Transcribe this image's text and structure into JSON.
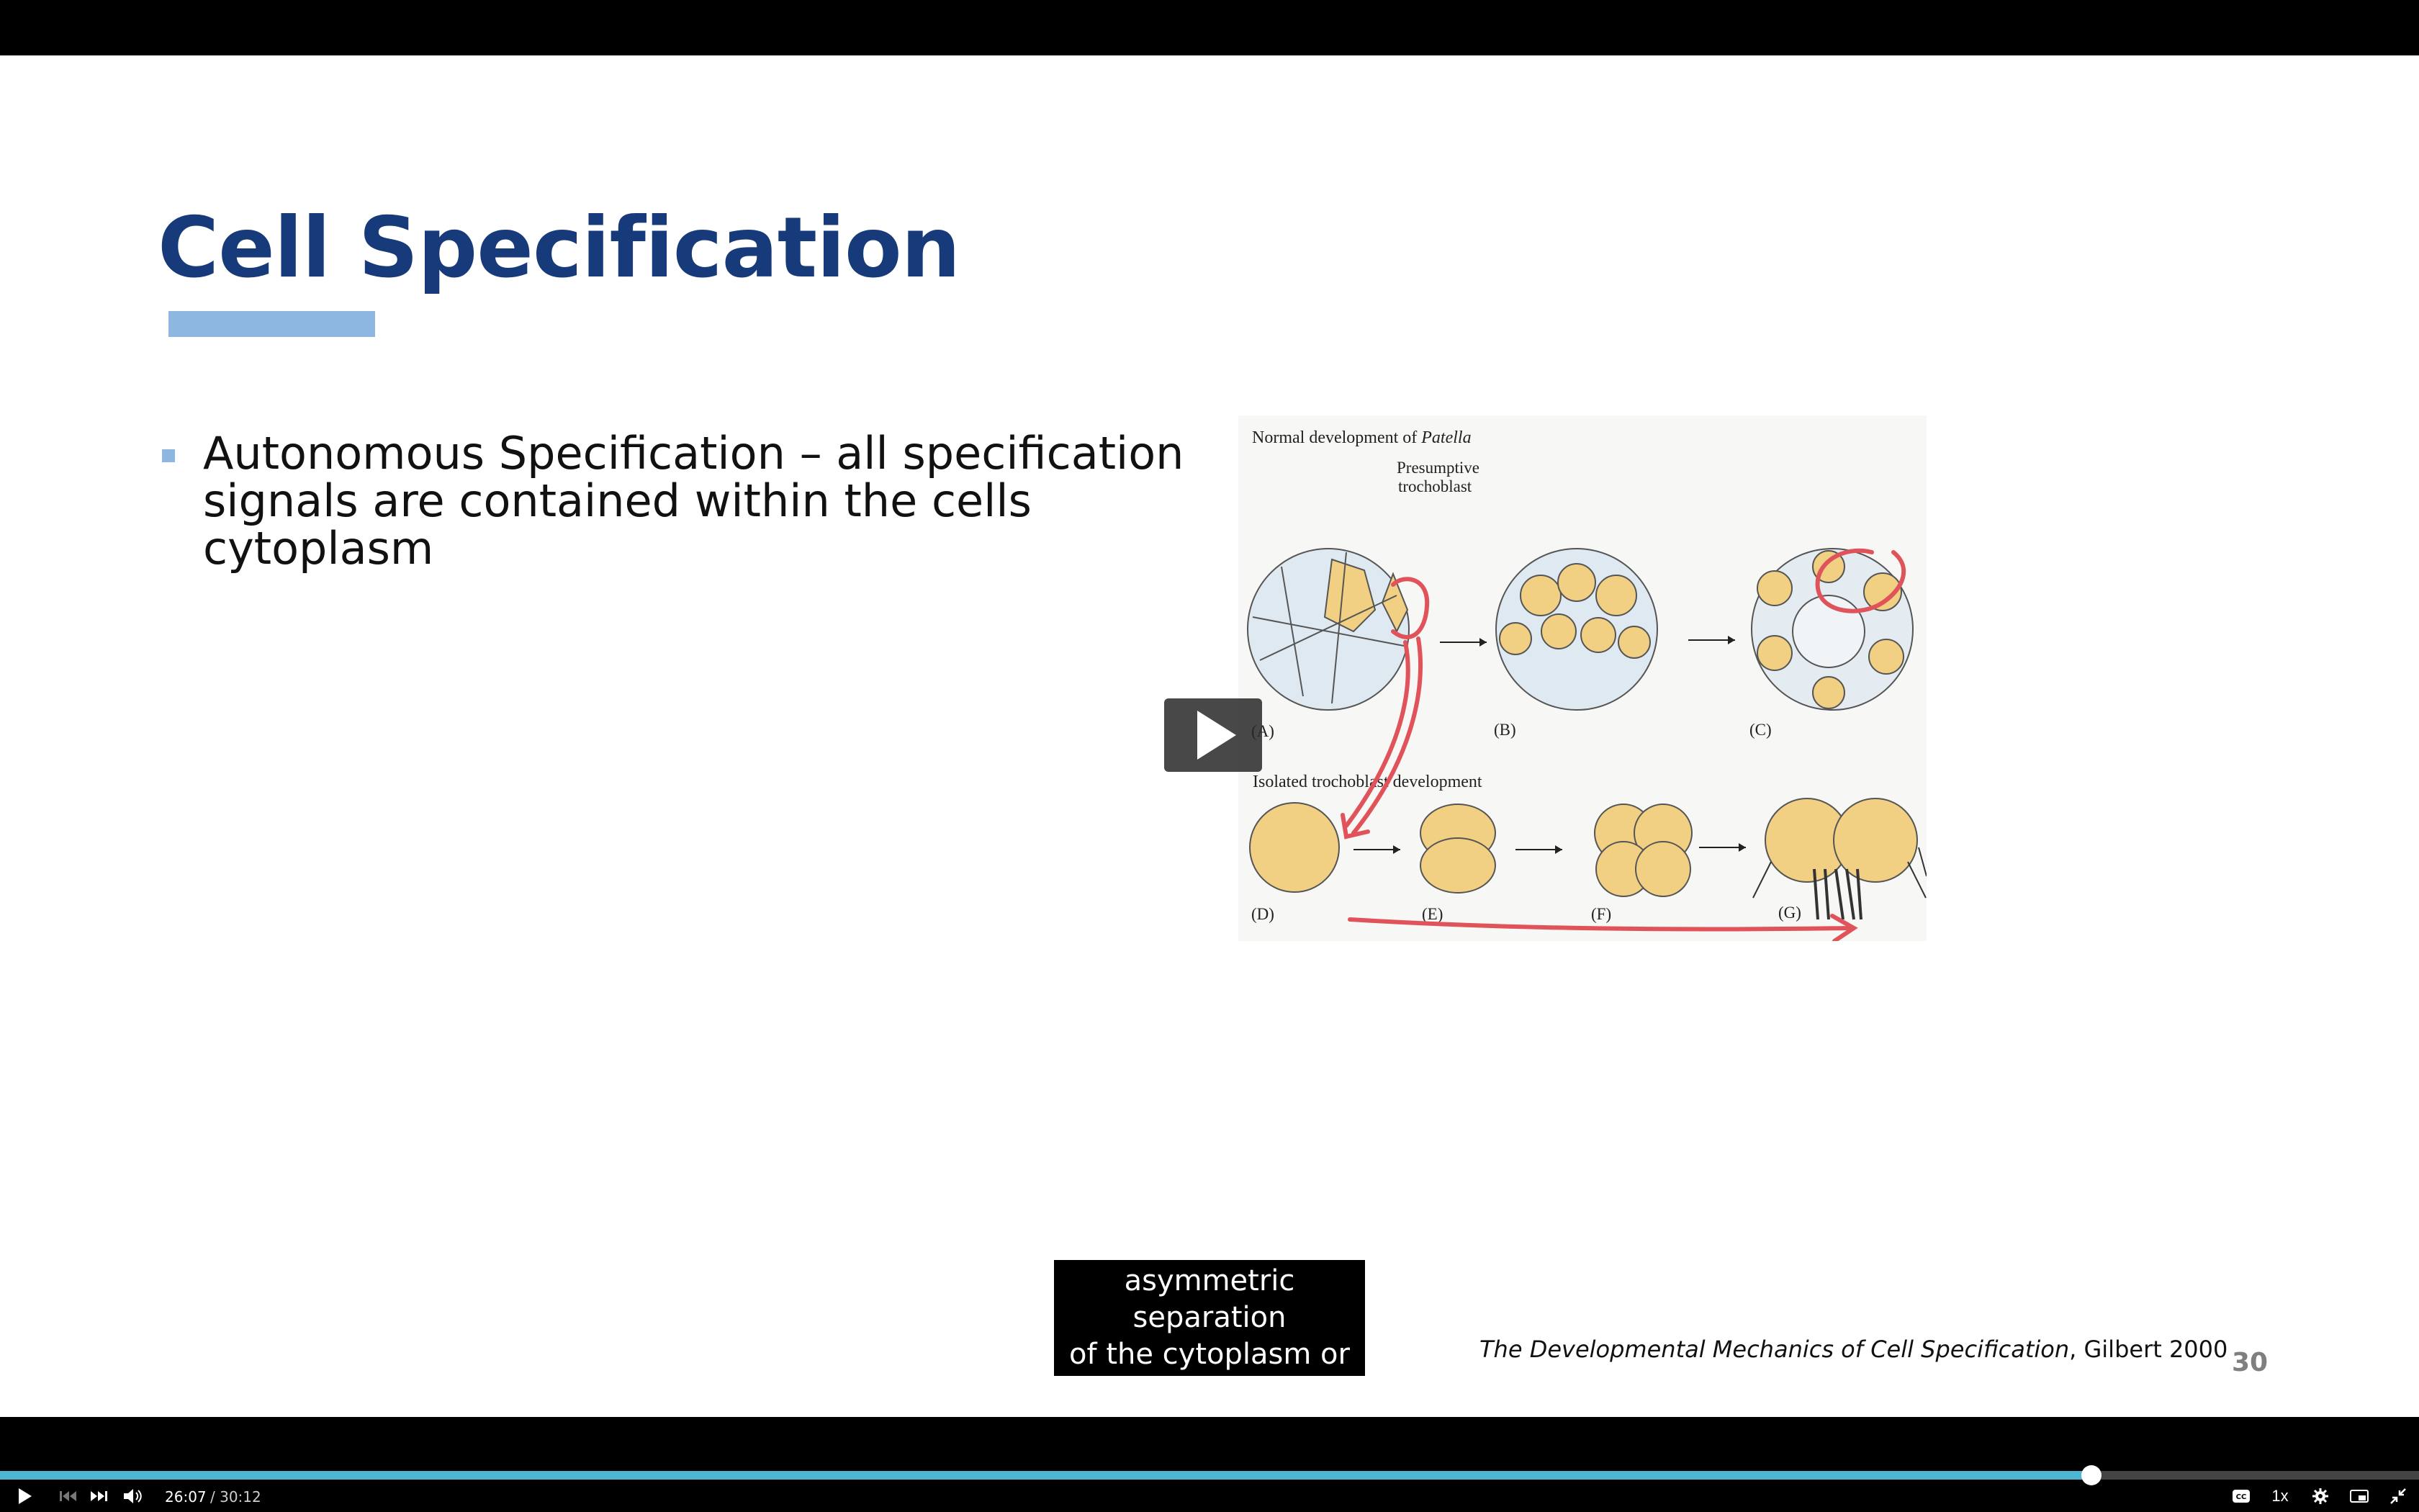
{
  "slide": {
    "title": "Cell Specification",
    "bullet": "Autonomous Specification – all specification signals are contained within the cells cytoplasm",
    "citation_italic": "The Developmental Mechanics of Cell Specification",
    "citation_rest": ", Gilbert 2000",
    "page_number": "30"
  },
  "figure": {
    "heading_top": "Normal development of ",
    "heading_top_italic": "Patella",
    "label_presumptive": "Presumptive",
    "label_trochoblast": "trochoblast",
    "heading_bottom": "Isolated trochoblast development",
    "panels": [
      "(A)",
      "(B)",
      "(C)",
      "(D)",
      "(E)",
      "(F)",
      "(G)"
    ],
    "colors": {
      "cell_yellow": "#f1cf83",
      "cell_blue": "#dfe9f1",
      "annotation_red": "#e0535a"
    }
  },
  "caption": {
    "line1": "asymmetric separation",
    "line2": "of the cytoplasm or"
  },
  "player": {
    "current_time": "26:07",
    "duration": "/ 30:12",
    "progress": 0.8645,
    "speed": "1x",
    "accent_color": "#4fb6d2",
    "icons": [
      "play-icon",
      "skip-back-icon",
      "skip-forward-icon",
      "volume-icon",
      "closed-captions-icon",
      "settings-icon",
      "picture-in-picture-icon",
      "exit-fullscreen-icon"
    ]
  }
}
